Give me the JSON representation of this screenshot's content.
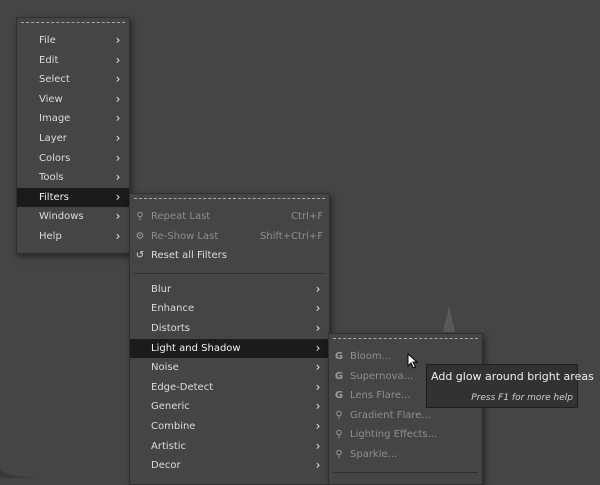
{
  "main_menu": {
    "items": [
      {
        "label": "File"
      },
      {
        "label": "Edit"
      },
      {
        "label": "Select"
      },
      {
        "label": "View"
      },
      {
        "label": "Image"
      },
      {
        "label": "Layer"
      },
      {
        "label": "Colors"
      },
      {
        "label": "Tools"
      },
      {
        "label": "Filters"
      },
      {
        "label": "Windows"
      },
      {
        "label": "Help"
      }
    ]
  },
  "filters_menu": {
    "top_items": [
      {
        "label": "Repeat Last",
        "shortcut": "Ctrl+F",
        "icon": "repeat-icon"
      },
      {
        "label": "Re-Show Last",
        "shortcut": "Shift+Ctrl+F",
        "icon": "reshow-icon"
      },
      {
        "label": "Reset all Filters",
        "icon": "reset-icon"
      }
    ],
    "submenus": [
      {
        "label": "Blur"
      },
      {
        "label": "Enhance"
      },
      {
        "label": "Distorts"
      },
      {
        "label": "Light and Shadow"
      },
      {
        "label": "Noise"
      },
      {
        "label": "Edge-Detect"
      },
      {
        "label": "Generic"
      },
      {
        "label": "Combine"
      },
      {
        "label": "Artistic"
      },
      {
        "label": "Decor"
      }
    ]
  },
  "light_shadow_menu": {
    "items": [
      {
        "label": "Bloom...",
        "icon": "gegl-icon"
      },
      {
        "label": "Supernova...",
        "icon": "gegl-icon"
      },
      {
        "label": "Lens Flare...",
        "icon": "gegl-icon"
      },
      {
        "label": "Gradient Flare...",
        "icon": "plugin-icon"
      },
      {
        "label": "Lighting Effects...",
        "icon": "plugin-icon"
      },
      {
        "label": "Sparkle...",
        "icon": "plugin-icon"
      }
    ]
  },
  "tooltip": {
    "text": "Add glow around bright areas",
    "help": "Press F1 for more help"
  },
  "icons": {
    "submenu_arrow": "chevron-right-icon"
  },
  "colors": {
    "background": "#454545",
    "highlight": "#1b1b1b",
    "tooltip_bg": "#323232"
  }
}
